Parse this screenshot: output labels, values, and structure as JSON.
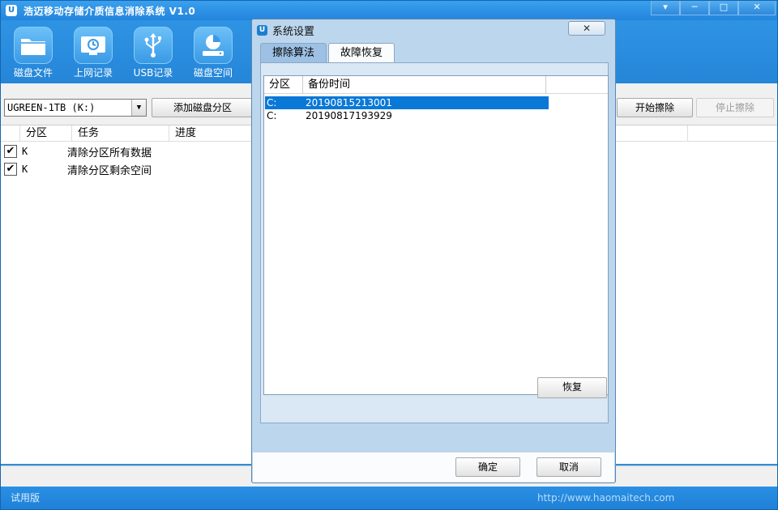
{
  "app": {
    "title": "浩迈移动存储介质信息消除系统 V1.0",
    "icon_letter": "U",
    "controls": {
      "menu": "▾",
      "minimize": "─",
      "maximize": "□",
      "close": "✕"
    }
  },
  "toolbar": {
    "items": [
      {
        "label": "磁盘文件",
        "icon": "folder-icon"
      },
      {
        "label": "上网记录",
        "icon": "web-history-icon"
      },
      {
        "label": "USB记录",
        "icon": "usb-icon"
      },
      {
        "label": "磁盘空间",
        "icon": "disk-space-icon"
      }
    ]
  },
  "drive": {
    "selected": "UGREEN-1TB (K:)"
  },
  "actions": {
    "add_partition": "添加磁盘分区",
    "start_erase": "开始擦除",
    "stop_erase": "停止擦除"
  },
  "task_list": {
    "columns": [
      "分区",
      "任务",
      "进度"
    ],
    "rows": [
      {
        "partition": "K",
        "task": "清除分区所有数据",
        "checked": "✔"
      },
      {
        "partition": "K",
        "task": "清除分区剩余空间",
        "checked": "✔"
      }
    ]
  },
  "statusbar": {
    "edition": "试用版",
    "url": "http://www.haomaitech.com"
  },
  "dialog": {
    "title": "系统设置",
    "close": "✕",
    "tabs": [
      "擦除算法",
      "故障恢复"
    ],
    "active_tab": "故障恢复",
    "backup_list": {
      "columns": [
        "分区",
        "备份时间"
      ],
      "rows": [
        {
          "partition": "C:",
          "time": "20190815213001",
          "selected": true
        },
        {
          "partition": "C:",
          "time": "20190817193929",
          "selected": false
        }
      ]
    },
    "restore_label": "恢复",
    "ok_label": "确定",
    "cancel_label": "取消"
  }
}
